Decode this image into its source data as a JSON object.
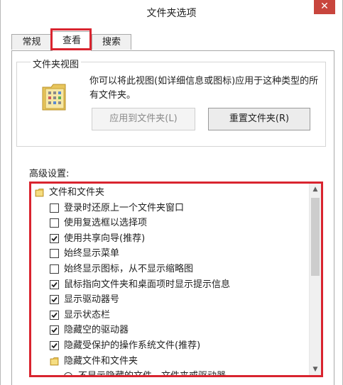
{
  "window": {
    "title": "文件夹选项",
    "close_glyph": "✕"
  },
  "tabs": [
    {
      "label": "常规"
    },
    {
      "label": "查看",
      "selected": true
    },
    {
      "label": "搜索"
    }
  ],
  "folder_views": {
    "group_label": "文件夹视图",
    "description": "你可以将此视图(如详细信息或图标)应用于这种类型的所有文件夹。",
    "apply_button": "应用到文件夹(L)",
    "reset_button": "重置文件夹(R)"
  },
  "advanced": {
    "label": "高级设置:",
    "items": [
      {
        "type": "folder",
        "label": "文件和文件夹",
        "indent": 0
      },
      {
        "type": "checkbox",
        "label": "登录时还原上一个文件夹窗口",
        "checked": false,
        "indent": 1
      },
      {
        "type": "checkbox",
        "label": "使用复选框以选择项",
        "checked": false,
        "indent": 1
      },
      {
        "type": "checkbox",
        "label": "使用共享向导(推荐)",
        "checked": true,
        "indent": 1
      },
      {
        "type": "checkbox",
        "label": "始终显示菜单",
        "checked": false,
        "indent": 1
      },
      {
        "type": "checkbox",
        "label": "始终显示图标，从不显示缩略图",
        "checked": false,
        "indent": 1
      },
      {
        "type": "checkbox",
        "label": "鼠标指向文件夹和桌面项时显示提示信息",
        "checked": true,
        "indent": 1
      },
      {
        "type": "checkbox",
        "label": "显示驱动器号",
        "checked": true,
        "indent": 1
      },
      {
        "type": "checkbox",
        "label": "显示状态栏",
        "checked": true,
        "indent": 1
      },
      {
        "type": "checkbox",
        "label": "隐藏空的驱动器",
        "checked": true,
        "indent": 1
      },
      {
        "type": "checkbox",
        "label": "隐藏受保护的操作系统文件(推荐)",
        "checked": true,
        "indent": 1
      },
      {
        "type": "folder",
        "label": "隐藏文件和文件夹",
        "indent": 1
      },
      {
        "type": "radio",
        "label": "不显示隐藏的文件、文件夹或驱动器",
        "checked": false,
        "indent": 2
      }
    ]
  },
  "colors": {
    "highlight": "#d9242f",
    "close": "#c8453d"
  }
}
